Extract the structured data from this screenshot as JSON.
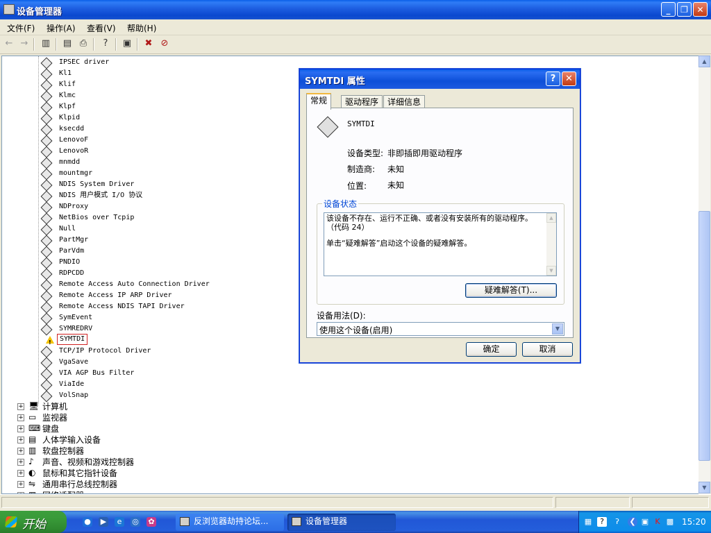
{
  "window": {
    "title": "设备管理器"
  },
  "menu": [
    "文件(F)",
    "操作(A)",
    "查看(V)",
    "帮助(H)"
  ],
  "toolbar_icons": [
    "back-icon",
    "forward-icon",
    "show-hide-tree-icon",
    "properties-icon",
    "print-icon",
    "help-icon",
    "scan-hardware-icon",
    "uninstall-icon",
    "disable-icon"
  ],
  "drivers": [
    "IPSEC driver",
    "Kl1",
    "Klif",
    "Klmc",
    "Klpf",
    "Klpid",
    "ksecdd",
    "LenovoF",
    "LenovoR",
    "mnmdd",
    "mountmgr",
    "NDIS System Driver",
    "NDIS 用户模式 I/O 协议",
    "NDProxy",
    "NetBios over Tcpip",
    "Null",
    "PartMgr",
    "ParVdm",
    "PNDIO",
    "RDPCDD",
    "Remote Access Auto Connection Driver",
    "Remote Access IP ARP Driver",
    "Remote Access NDIS TAPI Driver",
    "SymEvent",
    "SYMREDRV",
    "SYMTDI",
    "TCP/IP Protocol Driver",
    "VgaSave",
    "VIA AGP Bus Filter",
    "ViaIde",
    "VolSnap"
  ],
  "selected_driver": "SYMTDI",
  "categories": [
    {
      "icon": "computer-icon",
      "label": "计算机"
    },
    {
      "icon": "monitor-icon",
      "label": "监视器"
    },
    {
      "icon": "keyboard-icon",
      "label": "键盘"
    },
    {
      "icon": "hid-icon",
      "label": "人体学输入设备"
    },
    {
      "icon": "floppy-controller-icon",
      "label": "软盘控制器"
    },
    {
      "icon": "sound-icon",
      "label": "声音、视频和游戏控制器"
    },
    {
      "icon": "mouse-icon",
      "label": "鼠标和其它指针设备"
    },
    {
      "icon": "usb-icon",
      "label": "通用串行总线控制器"
    },
    {
      "icon": "network-icon",
      "label": "网络适配器"
    }
  ],
  "dialog": {
    "title": "SYMTDI 属性",
    "help_btn": "?",
    "close_btn": "✕",
    "tabs": [
      "常规",
      "驱动程序",
      "详细信息"
    ],
    "active_tab": "常规",
    "device_name": "SYMTDI",
    "props": [
      {
        "label": "设备类型:",
        "value": "非即插即用驱动程序"
      },
      {
        "label": "制造商:",
        "value": "未知"
      },
      {
        "label": "位置:",
        "value": "未知"
      }
    ],
    "status_group_label": "设备状态",
    "status_line1": "该设备不存在、运行不正确、或者没有安装所有的驱动程序。（代码 24）",
    "status_line2": "单击“疑难解答”启动这个设备的疑难解答。",
    "troubleshoot_btn": "疑难解答(T)...",
    "usage_label": "设备用法(D):",
    "usage_value": "使用这个设备(启用)",
    "ok_btn": "确定",
    "cancel_btn": "取消"
  },
  "taskbar": {
    "start_label": "开始",
    "tasks": [
      {
        "label": "反浏览器劫持论坛...",
        "active": false
      },
      {
        "label": "设备管理器",
        "active": true
      }
    ],
    "clock": "15:20"
  }
}
